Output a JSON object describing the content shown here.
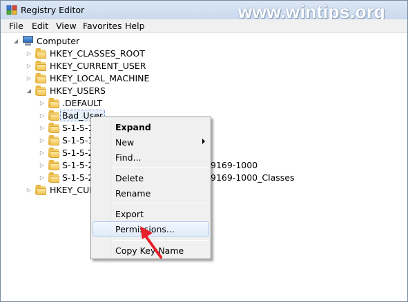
{
  "window": {
    "title": "Registry Editor",
    "watermark": "www.wintips.org",
    "icon": "registry-editor-icon"
  },
  "menubar": {
    "items": [
      "File",
      "Edit",
      "View",
      "Favorites",
      "Help"
    ]
  },
  "tree": {
    "root": "Computer",
    "nodes": [
      {
        "label": "HKEY_CLASSES_ROOT",
        "expanded": false
      },
      {
        "label": "HKEY_CURRENT_USER",
        "expanded": false
      },
      {
        "label": "HKEY_LOCAL_MACHINE",
        "expanded": false
      },
      {
        "label": "HKEY_USERS",
        "expanded": true
      },
      {
        "label": ".DEFAULT",
        "expanded": false
      },
      {
        "label": "Bad_User",
        "expanded": false,
        "selected": true
      },
      {
        "label": "S-1-5-18",
        "expanded": false
      },
      {
        "label": "S-1-5-19",
        "expanded": false
      },
      {
        "label": "S-1-5-20",
        "expanded": false
      },
      {
        "label": "9169-1000",
        "expanded": false
      },
      {
        "label": "9169-1000_Classes",
        "expanded": false
      },
      {
        "label": "HKEY_CURRENT_CONFIG",
        "expanded": false
      }
    ],
    "visible_fragments": {
      "s18": "S-1-5-18",
      "s19": "S-1-5-19",
      "s20": "S-1-5-20",
      "s21a": "S-1-5-21",
      "s21b": "S-1-5-21",
      "s21a_tail": "9169-1000",
      "s21b_tail": "9169-1000_Classes",
      "hkcc": "HKEY_CURI"
    }
  },
  "context_menu": {
    "items": [
      {
        "label": "Expand",
        "bold": true
      },
      {
        "label": "New",
        "submenu": true
      },
      {
        "label": "Find..."
      },
      {
        "label": "Delete"
      },
      {
        "label": "Rename"
      },
      {
        "label": "Export"
      },
      {
        "label": "Permissions...",
        "highlighted": true
      },
      {
        "label": "Copy Key Name"
      }
    ],
    "highlight_color": "#e1ecfa"
  },
  "colors": {
    "titlebar": "#dce7f5",
    "menubar": "#f0f0f0",
    "pointer": "#e8202a"
  }
}
